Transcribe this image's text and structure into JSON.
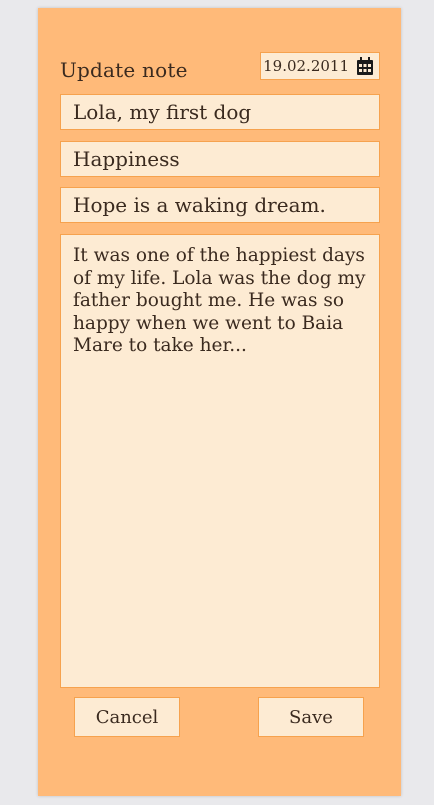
{
  "header": {
    "title": "Update note",
    "date": "19.02.2011",
    "date_icon": "calendar-icon"
  },
  "fields": {
    "title": "Lola, my first dog",
    "mood": "Happiness",
    "quote": "Hope is a waking dream."
  },
  "content": {
    "body": "It was one of the happiest days of my life. Lola was the dog my father bought me. He was so happy when we went to Baia Mare to take her..."
  },
  "actions": {
    "cancel_label": "Cancel",
    "save_label": "Save"
  },
  "colors": {
    "panel_bg": "#ffba79",
    "field_bg": "#fdebd3",
    "field_border": "#f6a24e",
    "text": "#3a2a1f"
  }
}
